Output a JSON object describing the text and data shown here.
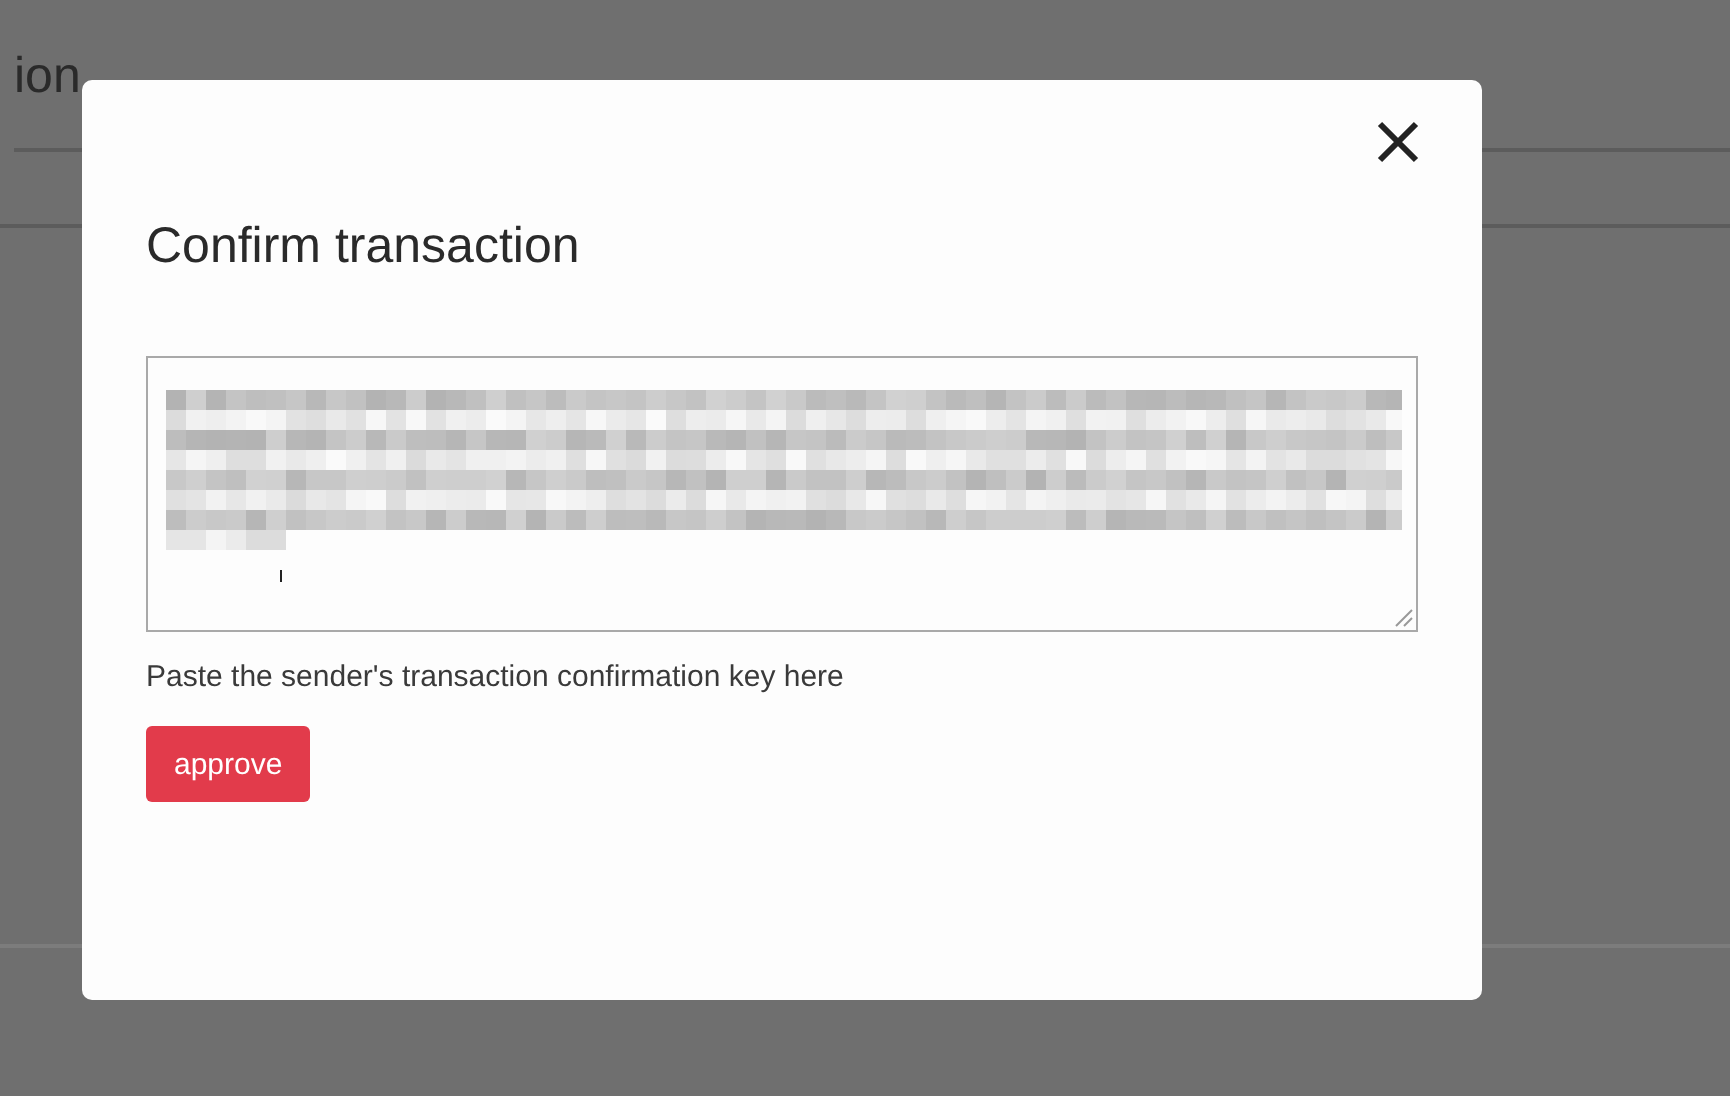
{
  "background_page": {
    "heading": "ion"
  },
  "dialog": {
    "title": "Confirm transaction",
    "key_field": {
      "kind": "pixelated"
    },
    "hint": "Paste the sender's transaction confirmation key here",
    "buttons": [
      {
        "label": "approve",
        "kind": "primary"
      }
    ]
  }
}
